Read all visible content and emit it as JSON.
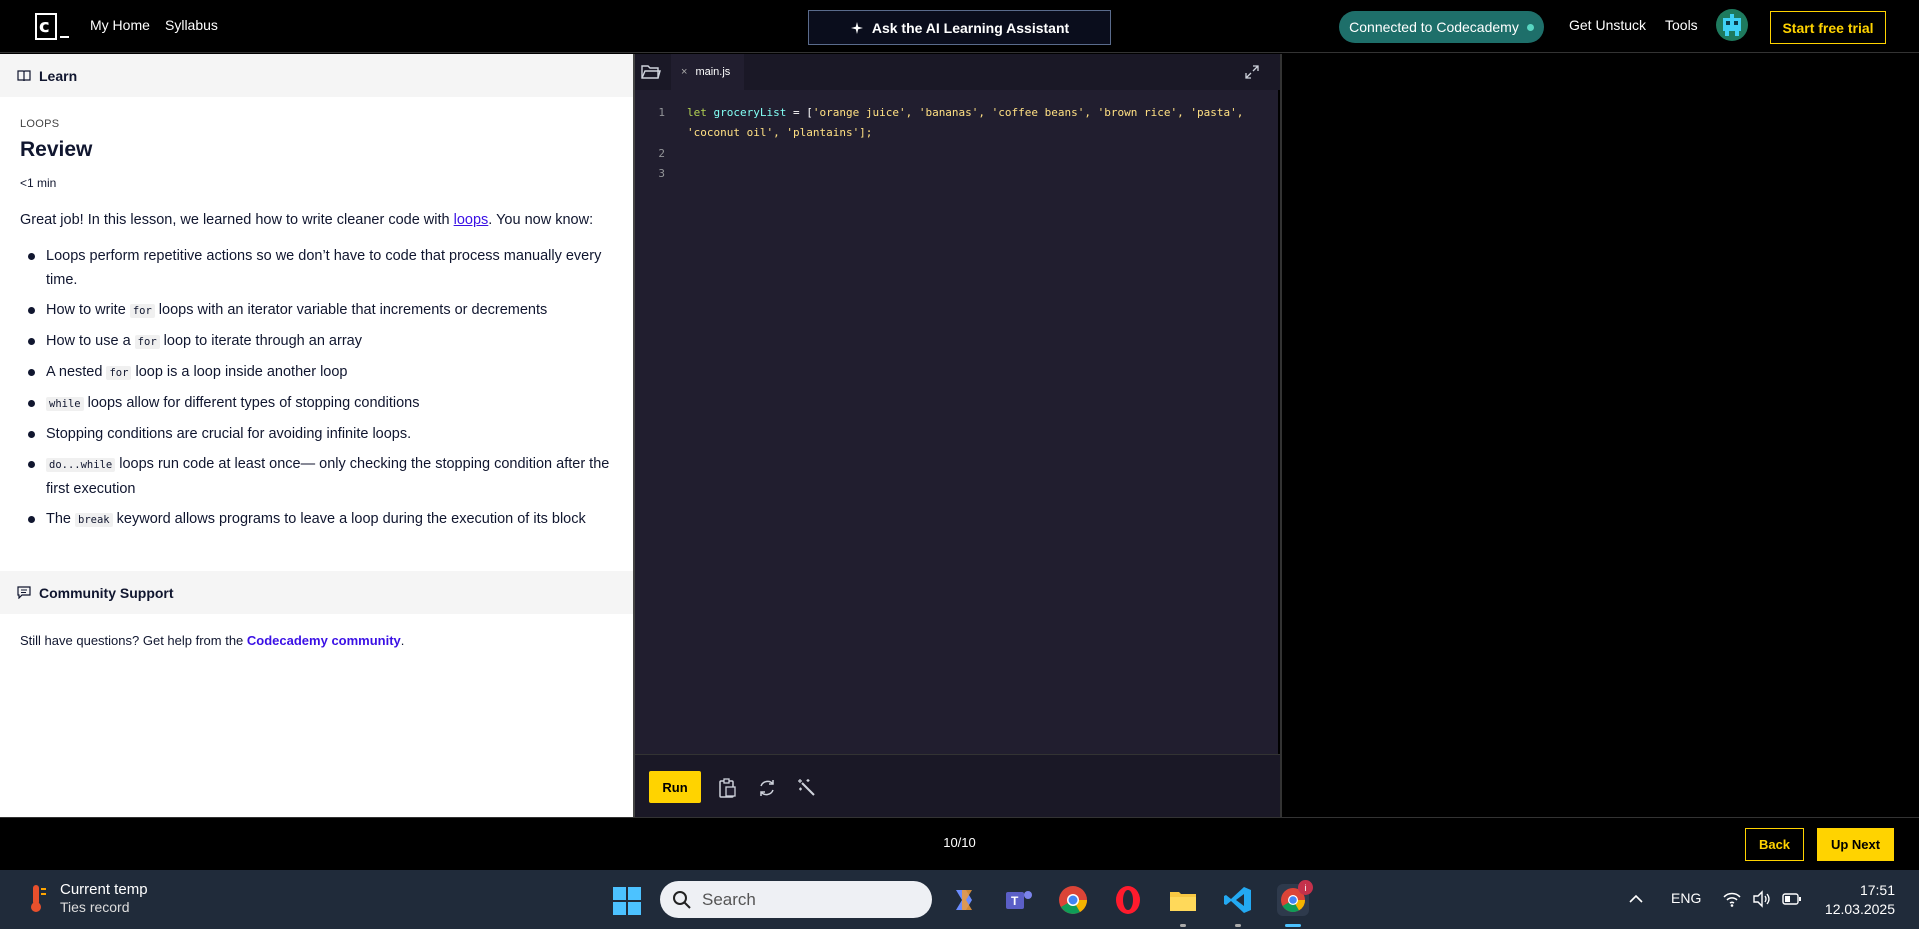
{
  "topnav": {
    "logo_text": "c",
    "my_home": "My Home",
    "syllabus": "Syllabus",
    "ai_assistant": "Ask the AI Learning Assistant",
    "connected": "Connected to Codecademy",
    "get_unstuck": "Get Unstuck",
    "tools": "Tools",
    "start_trial": "Start free trial"
  },
  "lesson": {
    "learn_tab": "Learn",
    "kicker": "LOOPS",
    "title": "Review",
    "duration": "<1 min",
    "intro_before": "Great job! In this lesson, we learned how to write cleaner code with ",
    "intro_link": "loops",
    "intro_after": ". You now know:",
    "points": [
      {
        "pre": "Loops perform repetitive actions so we don’t have to code that process manually every time.",
        "code": "",
        "post": ""
      },
      {
        "pre": "How to write ",
        "code": "for",
        "post": " loops with an iterator variable that increments or decrements"
      },
      {
        "pre": "How to use a ",
        "code": "for",
        "post": " loop to iterate through an array"
      },
      {
        "pre": "A nested ",
        "code": "for",
        "post": " loop is a loop inside another loop"
      },
      {
        "pre": "",
        "code": "while",
        "post": " loops allow for different types of stopping conditions"
      },
      {
        "pre": "Stopping conditions are crucial for avoiding infinite loops.",
        "code": "",
        "post": ""
      },
      {
        "pre": "",
        "code": "do...while",
        "post": " loops run code at least once— only checking the stopping condition after the first execution"
      },
      {
        "pre": "The ",
        "code": "break",
        "post": " keyword allows programs to leave a loop during the execution of its block"
      }
    ],
    "community_heading": "Community Support",
    "community_before": "Still have questions? Get help from the ",
    "community_link": "Codecademy community",
    "community_after": "."
  },
  "editor": {
    "filename": "main.js",
    "line_numbers": [
      "1",
      "2",
      "3"
    ],
    "code_line1a_kw": "let",
    "code_line1a_var": "groceryList",
    "code_line1a_rest": " = [",
    "code_line1a_strs": "'orange juice', 'bananas', 'coffee beans', 'brown rice', 'pasta',",
    "code_line1b": "'coconut oil', 'plantains'];",
    "run_label": "Run"
  },
  "bottombar": {
    "progress": "10/10",
    "back": "Back",
    "next": "Up Next"
  },
  "taskbar": {
    "weather_title": "Current temp",
    "weather_sub": "Ties record",
    "search_placeholder": "Search",
    "language": "ENG",
    "time": "17:51",
    "date": "12.03.2025",
    "badge": "i"
  },
  "colors": {
    "accent_yellow": "#ffd300",
    "link_purple": "#3a10e5",
    "editor_bg": "#211e2f",
    "connected_teal": "#1e6f6a"
  }
}
